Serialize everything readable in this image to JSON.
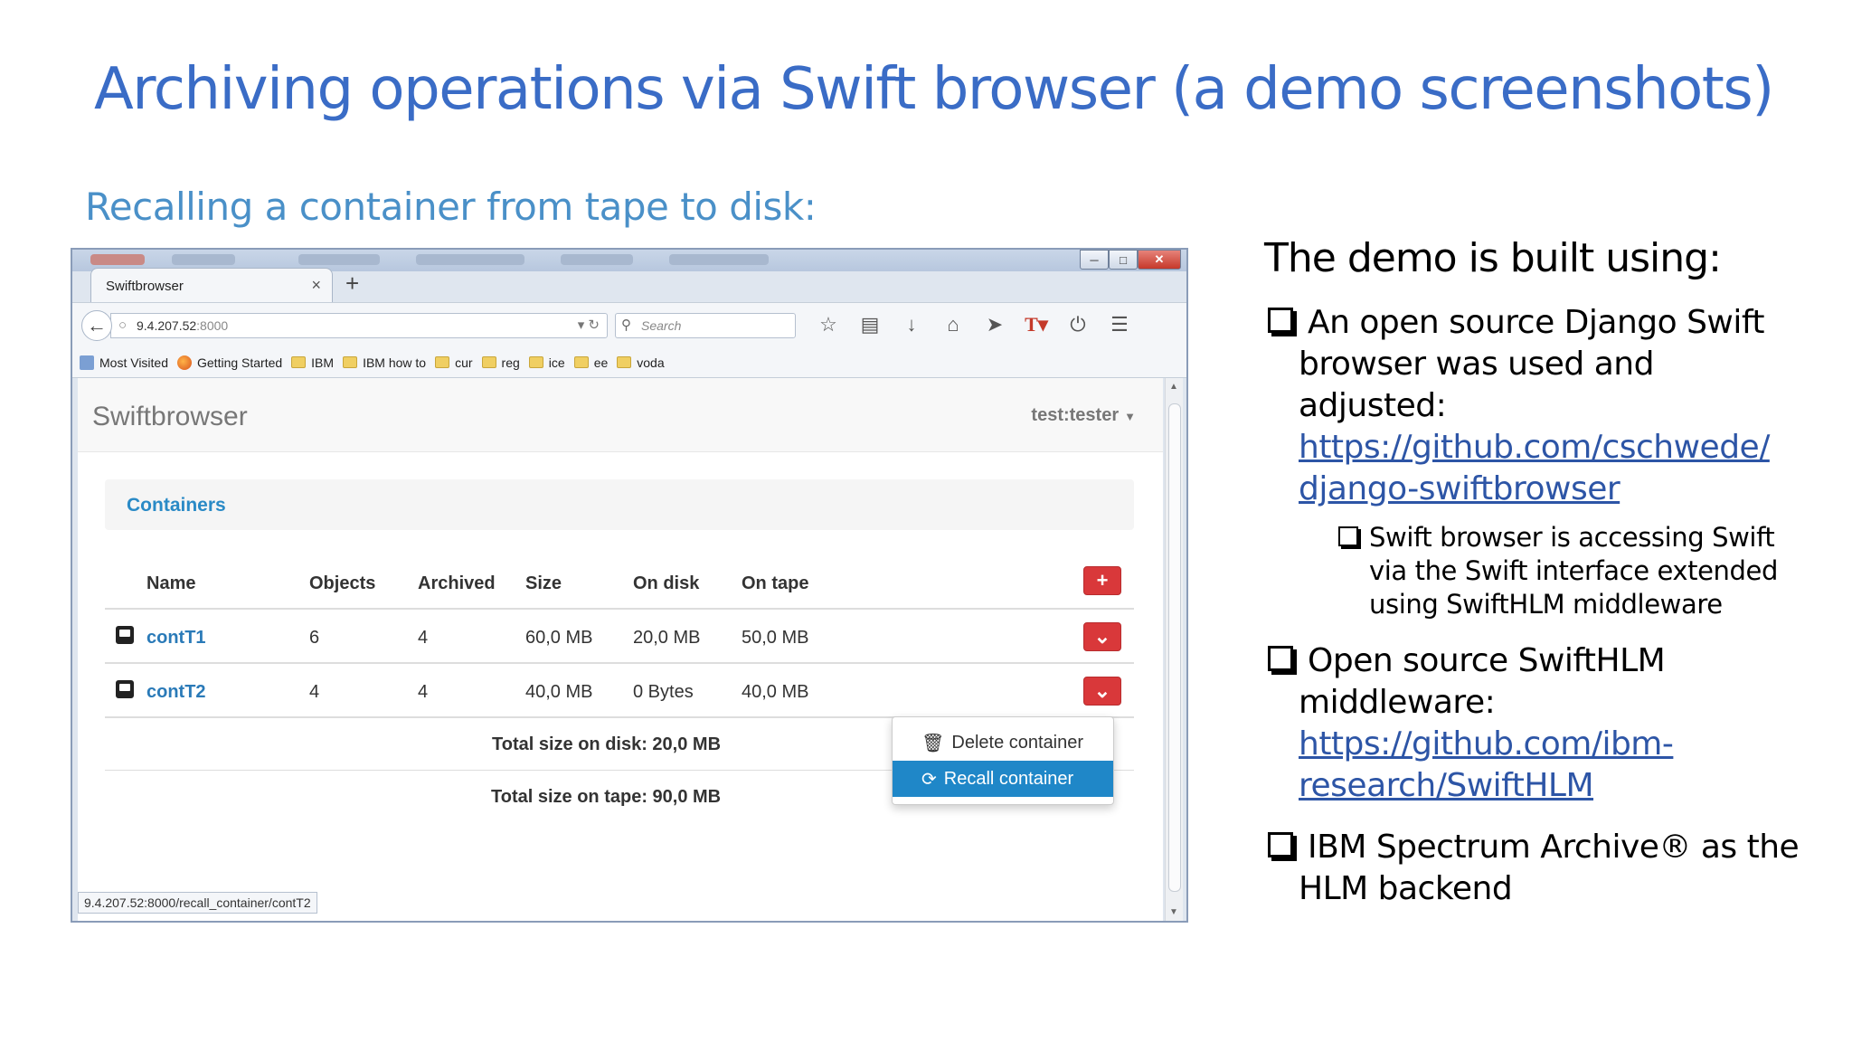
{
  "slide": {
    "title": "Archiving operations via Swift browser (a demo screenshots)",
    "subtitle": "Recalling a container from tape to disk:"
  },
  "browser": {
    "tab_title": "Swiftbrowser",
    "url_host": "9.4.207.52",
    "url_port": ":8000",
    "search_placeholder": "Search",
    "bookmarks": [
      "Most Visited",
      "Getting Started",
      "IBM",
      "IBM how to",
      "cur",
      "reg",
      "ice",
      "ee",
      "voda"
    ],
    "status_url": "9.4.207.52:8000/recall_container/contT2"
  },
  "app": {
    "brand": "Swiftbrowser",
    "user": "test:tester",
    "panel_title": "Containers",
    "columns": [
      "Name",
      "Objects",
      "Archived",
      "Size",
      "On disk",
      "On tape"
    ],
    "rows": [
      {
        "name": "contT1",
        "objects": "6",
        "archived": "4",
        "size": "60,0 MB",
        "on_disk": "20,0 MB",
        "on_tape": "50,0 MB"
      },
      {
        "name": "contT2",
        "objects": "4",
        "archived": "4",
        "size": "40,0 MB",
        "on_disk": "0 Bytes",
        "on_tape": "40,0 MB"
      }
    ],
    "total_disk": "Total size on disk: 20,0 MB",
    "total_tape": "Total size on tape: 90,0 MB",
    "menu": {
      "delete": "Delete container",
      "recall": "Recall container"
    },
    "colors": {
      "brand_link": "#2a7ab8",
      "danger": "#d9383a",
      "active": "#1f87c8"
    }
  },
  "right": {
    "heading": "The demo is built using:",
    "b1_l1": "An open source Django Swift",
    "b1_l2": "browser was used and",
    "b1_l3": "adjusted:",
    "b1_link1": "https://github.com/cschwede/",
    "b1_link2": "django-swiftbrowser",
    "s1_l1": "Swift browser is accessing Swift",
    "s1_l2": "via the Swift interface extended",
    "s1_l3": "using SwiftHLM middleware",
    "b2_l1": "Open source SwiftHLM",
    "b2_l2": "middleware:",
    "b2_link1": "https://github.com/ibm-",
    "b2_link2": "research/SwiftHLM",
    "b3_l1": "IBM Spectrum Archive® as the",
    "b3_l2": "HLM backend"
  }
}
